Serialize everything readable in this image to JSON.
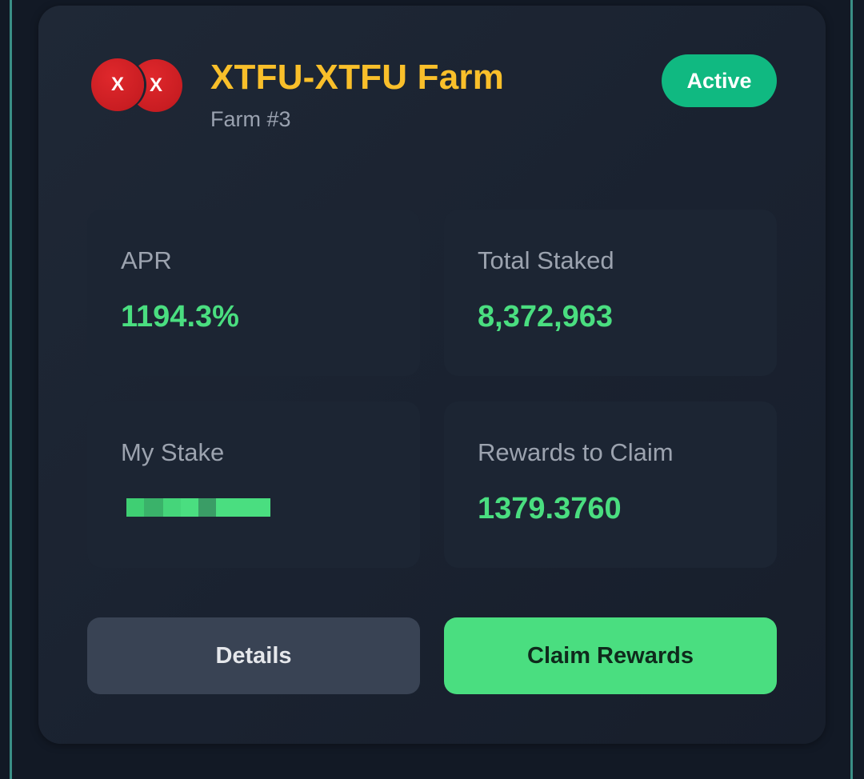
{
  "farm": {
    "token_a_symbol": "X",
    "token_b_symbol": "X",
    "title": "XTFU-XTFU Farm",
    "subtitle": "Farm #3",
    "status": "Active"
  },
  "stats": {
    "apr": {
      "label": "APR",
      "value": "1194.3%"
    },
    "total_staked": {
      "label": "Total Staked",
      "value": "8,372,963"
    },
    "my_stake": {
      "label": "My Stake"
    },
    "rewards": {
      "label": "Rewards to Claim",
      "value": "1379.3760"
    }
  },
  "actions": {
    "details_label": "Details",
    "claim_label": "Claim Rewards"
  },
  "colors": {
    "title": "#f9bf2a",
    "value": "#4ade80",
    "status": "#10b981",
    "token": "#d21f24",
    "claim_button": "#4ade80",
    "details_button": "#394354"
  }
}
